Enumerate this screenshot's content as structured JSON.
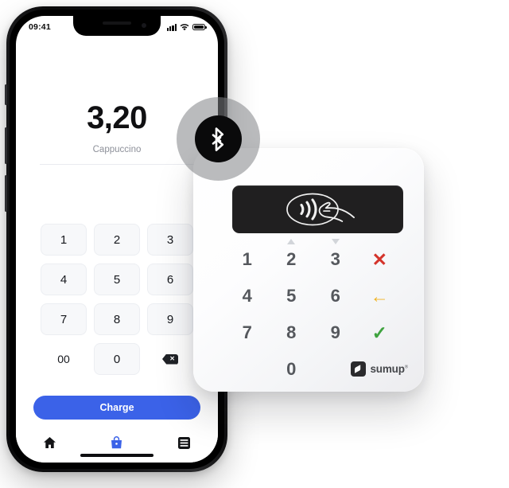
{
  "scene": {
    "background": "#ffffff",
    "description": "SumUp card reader next to a smartphone showing a payment app"
  },
  "phone": {
    "statusbar": {
      "time": "09:41",
      "icons": [
        "signal-bars-icon",
        "wifi-icon",
        "battery-icon"
      ]
    },
    "amount": {
      "value": "3,20",
      "label": "Cappuccino"
    },
    "keypad": [
      {
        "label": "1",
        "type": "digit"
      },
      {
        "label": "2",
        "type": "digit"
      },
      {
        "label": "3",
        "type": "digit"
      },
      {
        "label": "4",
        "type": "digit"
      },
      {
        "label": "5",
        "type": "digit"
      },
      {
        "label": "6",
        "type": "digit"
      },
      {
        "label": "7",
        "type": "digit"
      },
      {
        "label": "8",
        "type": "digit"
      },
      {
        "label": "9",
        "type": "digit"
      },
      {
        "label": "00",
        "type": "double-zero"
      },
      {
        "label": "0",
        "type": "digit"
      },
      {
        "label": "",
        "type": "backspace"
      }
    ],
    "backspace_glyph": "✕",
    "charge_button": {
      "label": "Charge",
      "color": "#3B62E8",
      "text_color": "#ffffff"
    },
    "tabbar": [
      {
        "name": "home",
        "icon": "home-icon",
        "active": false,
        "color": "#131416"
      },
      {
        "name": "sell",
        "icon": "shopping-bag-icon",
        "active": true,
        "color": "#3B62E8"
      },
      {
        "name": "more",
        "icon": "list-menu-icon",
        "active": false,
        "color": "#131416"
      }
    ]
  },
  "bluetooth_badge": {
    "icon": "bluetooth-icon",
    "ring_color": "rgba(130,132,135,0.55)",
    "core_color": "#0a0a0b",
    "glyph_color": "#ffffff"
  },
  "reader": {
    "nfc": {
      "icon": "contactless-payment-icon",
      "strip_color": "#201f20",
      "glyph_color": "#f2f2f2"
    },
    "keypad": [
      {
        "label": "1",
        "kind": "digit"
      },
      {
        "label": "2",
        "kind": "digit",
        "marker": "up-triangle"
      },
      {
        "label": "3",
        "kind": "digit",
        "marker": "down-triangle"
      },
      {
        "label": "✕",
        "kind": "cancel",
        "color": "#D4342B",
        "icon": "cancel-x-icon"
      },
      {
        "label": "4",
        "kind": "digit"
      },
      {
        "label": "5",
        "kind": "digit"
      },
      {
        "label": "6",
        "kind": "digit"
      },
      {
        "label": "←",
        "kind": "back",
        "color": "#F0B323",
        "icon": "back-arrow-icon"
      },
      {
        "label": "7",
        "kind": "digit"
      },
      {
        "label": "8",
        "kind": "digit"
      },
      {
        "label": "9",
        "kind": "digit"
      },
      {
        "label": "✓",
        "kind": "confirm",
        "color": "#3FA33F",
        "icon": "confirm-check-icon"
      },
      {
        "label": "",
        "kind": "empty"
      },
      {
        "label": "0",
        "kind": "digit"
      },
      {
        "label": "",
        "kind": "empty"
      },
      {
        "label": "",
        "kind": "empty"
      }
    ],
    "digit_color": "#55588d",
    "brand": {
      "wordmark": "sumup",
      "registered": "®",
      "mark_icon": "sumup-logo-icon",
      "mark_bg": "#2b2b2d"
    }
  }
}
